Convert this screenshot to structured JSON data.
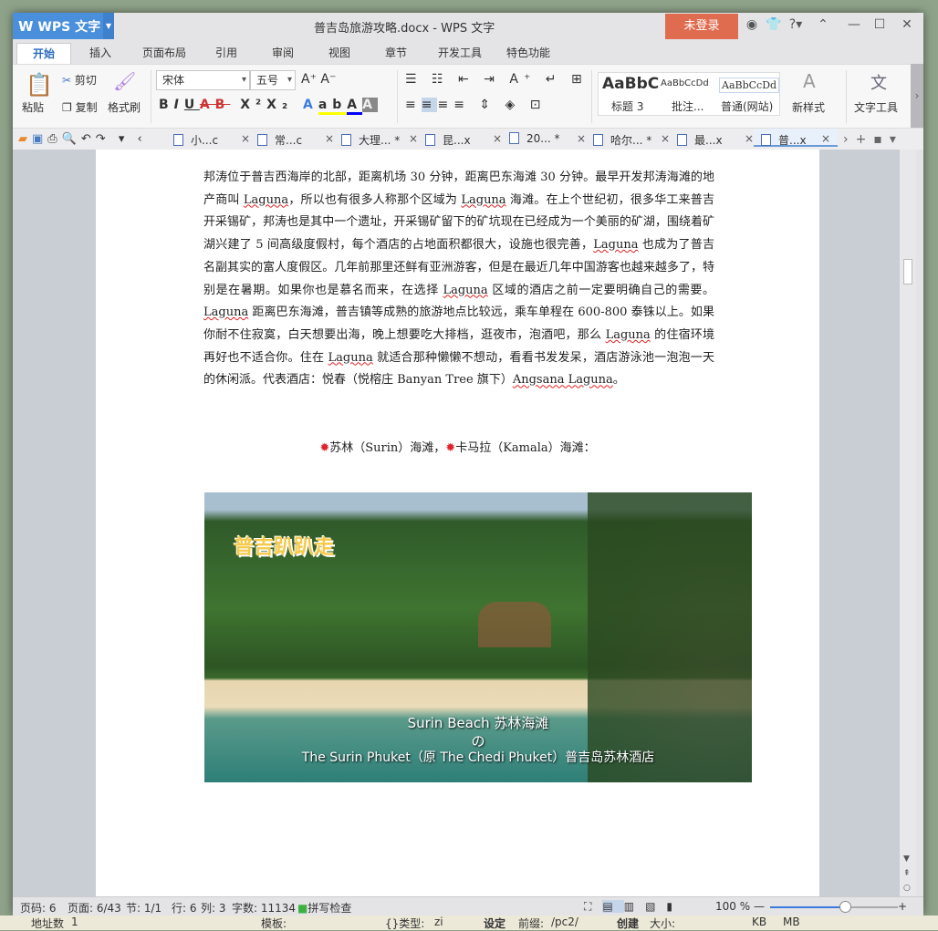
{
  "app": {
    "name": "WPS 文字",
    "title": "普吉岛旅游攻略.docx - WPS 文字",
    "login": "未登录"
  },
  "tabs": [
    "开始",
    "插入",
    "页面布局",
    "引用",
    "审阅",
    "视图",
    "章节",
    "开发工具",
    "特色功能"
  ],
  "ribbon": {
    "paste": "粘贴",
    "cut": "剪切",
    "copy": "复制",
    "format_painter": "格式刷",
    "font": "宋体",
    "size": "五号",
    "styles": [
      {
        "sample": "AaBbC",
        "name": "标题 3"
      },
      {
        "sample": "AaBbCcDd",
        "name": "批注..."
      },
      {
        "sample": "AaBbCcDd",
        "name": "普通(网站)"
      }
    ],
    "new_style": "新样式",
    "text_tools": "文字工具"
  },
  "doc_tabs": [
    {
      "label": "小...c"
    },
    {
      "label": "常...c"
    },
    {
      "label": "大理... *"
    },
    {
      "label": "昆...x"
    },
    {
      "label": "20... *"
    },
    {
      "label": "哈尔... *"
    },
    {
      "label": "最...x"
    },
    {
      "label": "普...x",
      "active": true
    }
  ],
  "document": {
    "subheading_a": "苏林（Surin）海滩，",
    "subheading_b": "卡马拉（Kamala）海滩：",
    "photo_caption1": "Surin Beach 苏林海滩",
    "photo_caption2": "の",
    "photo_caption3": "The Surin Phuket（原 The Chedi Phuket）普吉岛苏林酒店",
    "photo_logo": "普吉趴趴走"
  },
  "status": {
    "page_no": "页码: 6",
    "pages": "页面: 6/43",
    "section": "节: 1/1",
    "row": "行: 6",
    "col": "列: 3",
    "words": "字数: 11134",
    "spell": "拼写检查",
    "zoom": "100 %",
    "zoom_percent": 100
  },
  "bottom": {
    "a": "地址数",
    "a_val": "1",
    "b": "模板:",
    "c": "{}类型:",
    "c_val": "zi",
    "d": "设定",
    "e": "前缀:",
    "e_val": "/pc2/",
    "f": "创建",
    "g": "大小:",
    "h": "KB",
    "i": "MB"
  }
}
